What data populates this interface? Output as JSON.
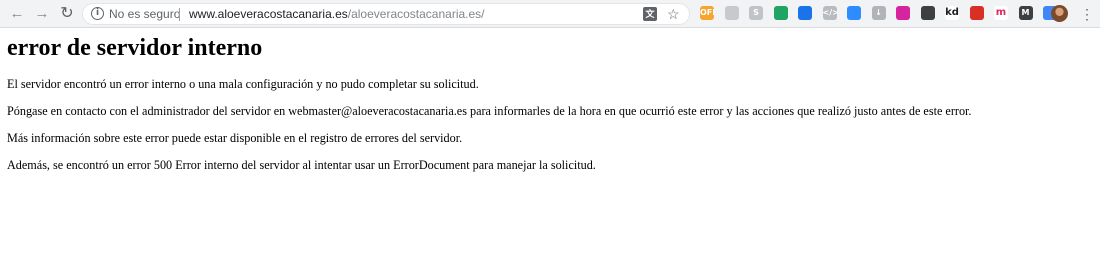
{
  "browser": {
    "security_label": "No es seguro",
    "url_host": "www.aloeveracostacanaria.es",
    "url_path": "/aloeveracostacanaria.es/",
    "nav": {
      "back_icon": "arrow-left-icon",
      "forward_icon": "arrow-right-icon",
      "reload_icon": "reload-icon"
    },
    "extensions": [
      {
        "name": "off-badge-icon",
        "label": "OFF",
        "color": "#f4a630"
      },
      {
        "name": "gray-extension-icon",
        "label": "",
        "color": "#c7c9cc"
      },
      {
        "name": "skype-icon",
        "label": "S",
        "color": "#c0c3c7"
      },
      {
        "name": "grammarly-icon",
        "label": "",
        "color": "#1fa463"
      },
      {
        "name": "search-extension-icon",
        "label": "",
        "color": "#1a73e8"
      },
      {
        "name": "code-icon",
        "label": "</>",
        "color": "#b8bbbf"
      },
      {
        "name": "zoom-icon",
        "label": "",
        "color": "#2d8cff"
      },
      {
        "name": "download-icon",
        "label": "↓",
        "color": "#b0b3b8"
      },
      {
        "name": "instagram-icon",
        "label": "",
        "color": "#d6249f"
      },
      {
        "name": "shield-extension-icon",
        "label": "",
        "color": "#3c4043"
      },
      {
        "name": "kd-icon",
        "label": "kd",
        "color": "#ffffff"
      },
      {
        "name": "flag-extension-icon",
        "label": "",
        "color": "#d93025"
      },
      {
        "name": "m-red-icon",
        "label": "m",
        "color": "#ffffff"
      },
      {
        "name": "m-dark-icon",
        "label": "M",
        "color": "#3c4043"
      },
      {
        "name": "screen-extension-icon",
        "label": "",
        "color": "#4285f4"
      }
    ]
  },
  "page": {
    "title": "error de servidor interno",
    "paragraphs": [
      "El servidor encontró un error interno o una mala configuración y no pudo completar su solicitud.",
      "Póngase en contacto con el administrador del servidor en webmaster@aloeveracostacanaria.es para informarles de la hora en que ocurrió este error y las acciones que realizó justo antes de este error.",
      "Más información sobre este error puede estar disponible en el registro de errores del servidor.",
      "Además, se encontró un error 500 Error interno del servidor al intentar usar un ErrorDocument para manejar la solicitud."
    ]
  }
}
